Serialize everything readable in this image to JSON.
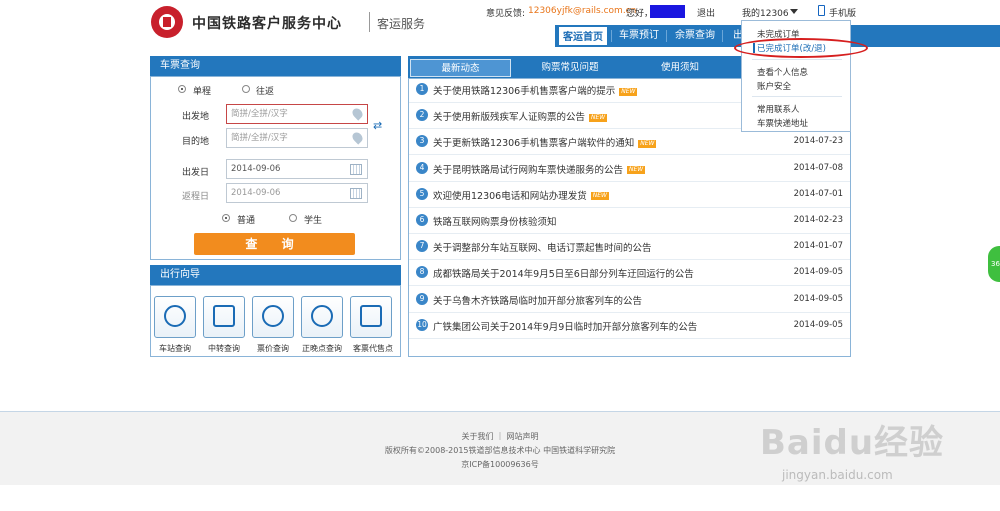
{
  "header": {
    "logo_text": "中国铁路客户服务中心",
    "logo_sub": "客运服务",
    "feedback_label": "意见反馈:",
    "feedback_email": "12306yjfk@rails.com.cn",
    "greeting": "您好，",
    "logout": "退出",
    "my_account": "我的12306",
    "mobile": "手机版"
  },
  "nav": {
    "items": [
      "客运首页",
      "车票预订",
      "余票查询",
      "出"
    ]
  },
  "dropdown": {
    "items": [
      "未完成订单",
      "已完成订单(改/退)",
      "查看个人信息",
      "账户安全",
      "常用联系人",
      "车票快递地址"
    ]
  },
  "ticket_query": {
    "title": "车票查询",
    "trip_single": "单程",
    "trip_return": "往返",
    "from_label": "出发地",
    "to_label": "目的地",
    "station_placeholder": "简拼/全拼/汉字",
    "depart_label": "出发日",
    "return_label": "返程日",
    "depart_date": "2014-09-06",
    "return_date": "2014-09-06",
    "type_normal": "普通",
    "type_student": "学生",
    "query_button": "查 询"
  },
  "travel_guide": {
    "title": "出行向导",
    "items": [
      "车站查询",
      "中转查询",
      "票价查询",
      "正晚点查询",
      "客票代售点"
    ]
  },
  "news": {
    "tabs": [
      "最新动态",
      "购票常见问题",
      "使用须知"
    ],
    "new_badge": "NEW",
    "rows": [
      {
        "num": "1",
        "title": "关于使用铁路12306手机售票客户端的提示",
        "date": "",
        "new": true
      },
      {
        "num": "2",
        "title": "关于使用新版残疾军人证购票的公告",
        "date": "",
        "new": true
      },
      {
        "num": "3",
        "title": "关于更新铁路12306手机售票客户端软件的通知",
        "date": "2014-07-23",
        "new": true
      },
      {
        "num": "4",
        "title": "关于昆明铁路局试行网购车票快递服务的公告",
        "date": "2014-07-08",
        "new": true
      },
      {
        "num": "5",
        "title": "欢迎使用12306电话和网站办理发货",
        "date": "2014-07-01",
        "new": true
      },
      {
        "num": "6",
        "title": "铁路互联网购票身份核验须知",
        "date": "2014-02-23",
        "new": false
      },
      {
        "num": "7",
        "title": "关于调整部分车站互联网、电话订票起售时间的公告",
        "date": "2014-01-07",
        "new": false
      },
      {
        "num": "8",
        "title": "成都铁路局关于2014年9月5日至6日部分列车迂回运行的公告",
        "date": "2014-09-05",
        "new": false
      },
      {
        "num": "9",
        "title": "关于乌鲁木齐铁路局临时加开部分旅客列车的公告",
        "date": "2014-09-05",
        "new": false
      },
      {
        "num": "10",
        "title": "广铁集团公司关于2014年9月9日临时加开部分旅客列车的公告",
        "date": "2014-09-05",
        "new": false
      }
    ]
  },
  "footer": {
    "links": "关于我们 ｜ 网站声明",
    "copyright": "版权所有©2008-2015铁道部信息技术中心   中国铁道科学研究院",
    "icp": "京ICP备10009636号"
  },
  "side_bubble": "36",
  "watermark": {
    "brand": "Baidu经验",
    "url": "jingyan.baidu.com"
  },
  "colors": {
    "nav_blue": "#2377bd",
    "accent_orange": "#f28c1e",
    "highlight_red": "#d61f1f"
  }
}
